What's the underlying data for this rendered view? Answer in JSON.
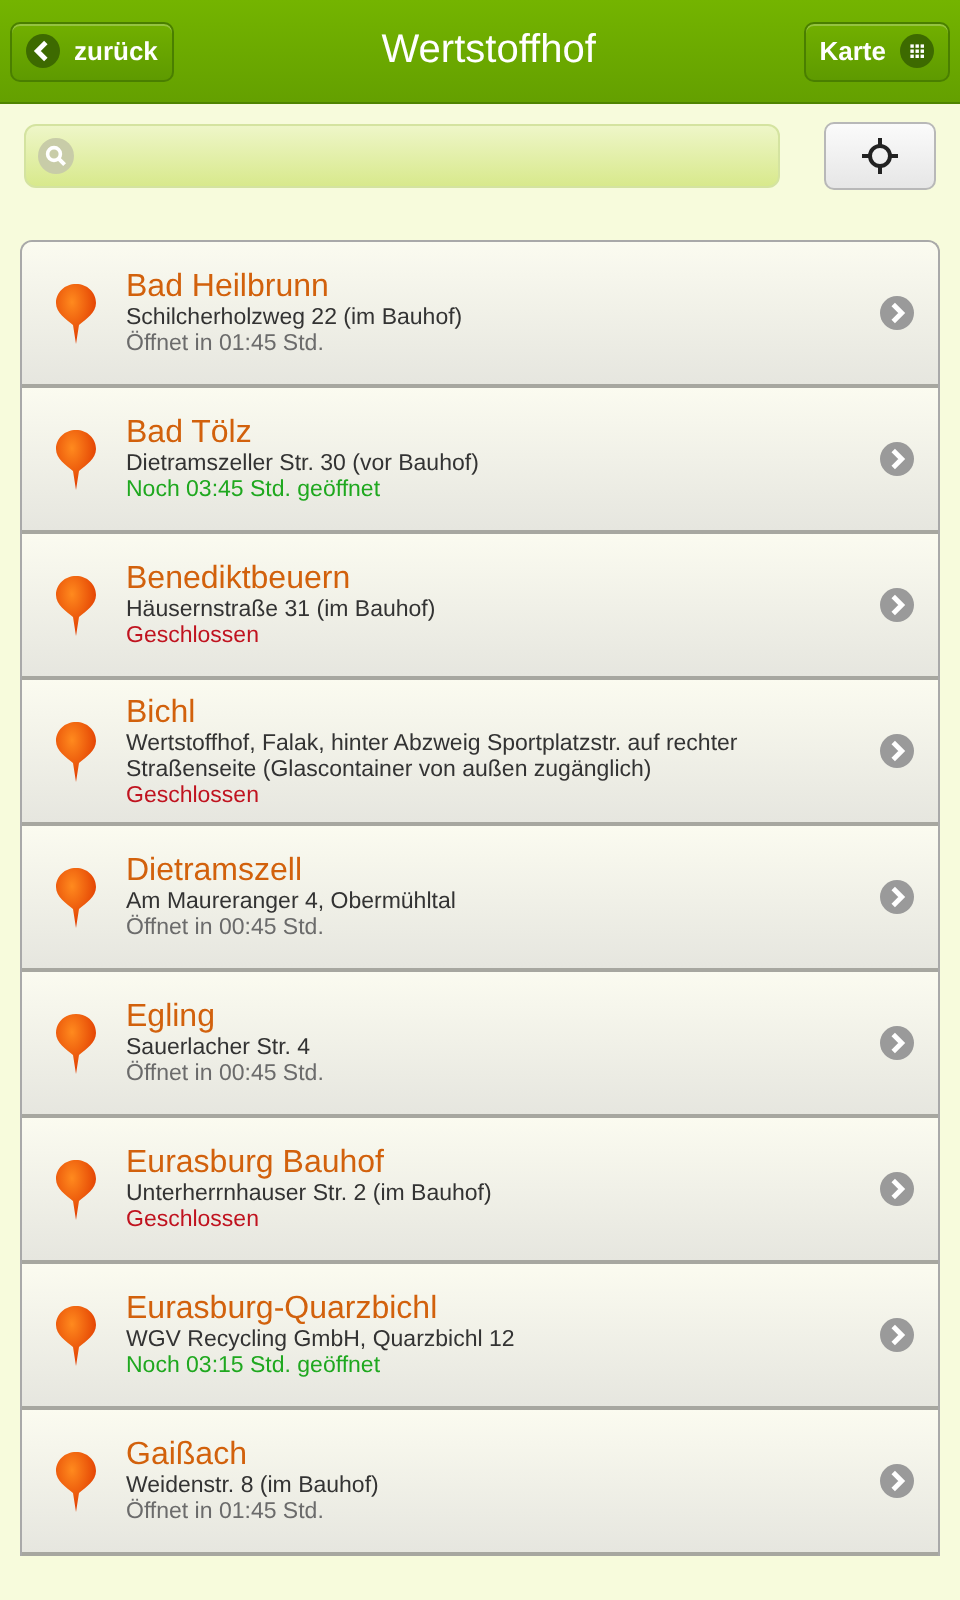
{
  "header": {
    "back_button": "zurück",
    "title": "Wertstoffhof",
    "map_button": "Karte"
  },
  "locations": [
    {
      "name": "Bad Heilbrunn",
      "address": "Schilcherholzweg 22 (im Bauhof)",
      "status": "Öffnet in 01:45 Std.",
      "color": "#6b6b6b"
    },
    {
      "name": "Bad Tölz",
      "address": "Dietramszeller Str. 30 (vor Bauhof)",
      "status": "Noch 03:45 Std. geöffnet",
      "color": "#1fa81f"
    },
    {
      "name": "Benediktbeuern",
      "address": "Häusernstraße 31 (im Bauhof)",
      "status": "Geschlossen",
      "color": "#c0131f"
    },
    {
      "name": "Bichl",
      "address": "Wertstoffhof,  Falak, hinter Abzweig Sportplatzstr. auf rechter Straßenseite (Glascontainer von außen zugänglich)",
      "status": "Geschlossen",
      "color": "#c0131f"
    },
    {
      "name": "Dietramszell",
      "address": "Am Maureranger 4, Obermühltal",
      "status": "Öffnet in 00:45 Std.",
      "color": "#6b6b6b"
    },
    {
      "name": "Egling",
      "address": "Sauerlacher Str. 4",
      "status": "Öffnet in 00:45 Std.",
      "color": "#6b6b6b"
    },
    {
      "name": "Eurasburg Bauhof",
      "address": "Unterherrnhauser Str. 2 (im Bauhof)",
      "status": "Geschlossen",
      "color": "#c0131f"
    },
    {
      "name": "Eurasburg-Quarzbichl",
      "address": "WGV Recycling GmbH, Quarzbichl 12",
      "status": "Noch 03:15 Std. geöffnet",
      "color": "#1fa81f"
    },
    {
      "name": "Gaißach",
      "address": "Weidenstr. 8 (im Bauhof)",
      "status": "Öffnet in 01:45 Std.",
      "color": "#6b6b6b"
    }
  ]
}
